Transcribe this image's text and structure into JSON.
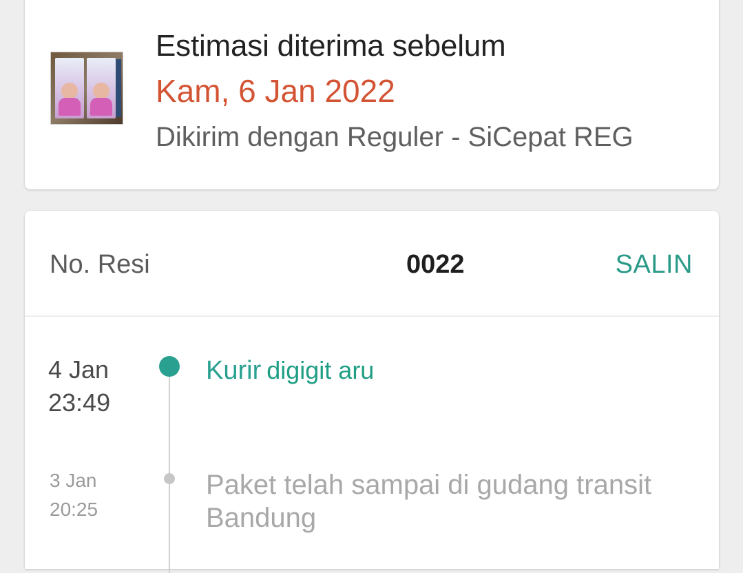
{
  "estimate": {
    "title": "Estimasi diterima sebelum",
    "date": "Kam, 6 Jan 2022",
    "shipping": "Dikirim dengan Reguler - SiCepat REG",
    "product_image_icon": "product-thumbnail"
  },
  "tracking": {
    "resi_label": "No. Resi",
    "resi_number": "0022",
    "copy_label": "SALIN",
    "events": [
      {
        "date": "4 Jan",
        "time": "23:49",
        "status": "Kurir",
        "detail": "digigit aru"
      },
      {
        "date": "3 Jan",
        "time": "20:25",
        "status": "Paket telah sampai di gudang transit Bandung"
      }
    ]
  },
  "colors": {
    "accent": "#2aa090",
    "date_highlight": "#d35434",
    "muted_text": "#a8a8a8"
  }
}
